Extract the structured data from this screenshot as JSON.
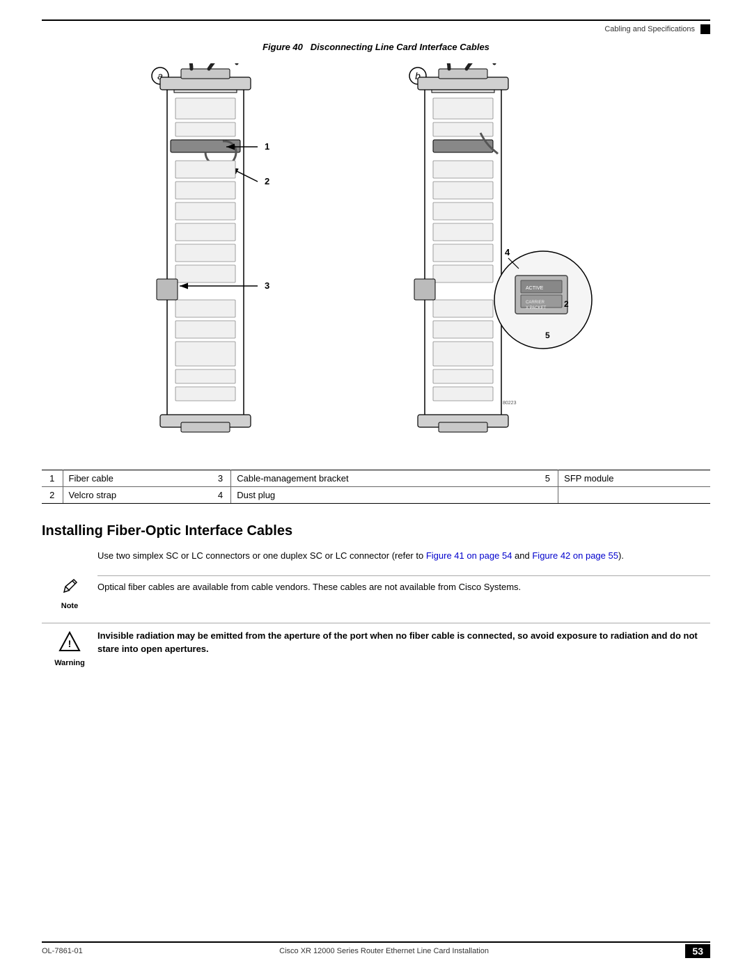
{
  "header": {
    "section_title": "Cabling and Specifications",
    "black_box": true
  },
  "figure": {
    "number": "40",
    "title": "Disconnecting Line Card Interface Cables",
    "label_a": "a",
    "label_b": "b"
  },
  "legend": {
    "rows": [
      {
        "num1": "1",
        "item1": "Fiber cable",
        "num2": "3",
        "item2": "Cable-management bracket",
        "num3": "5",
        "item3": "SFP module"
      },
      {
        "num1": "2",
        "item1": "Velcro strap",
        "num2": "4",
        "item2": "Dust plug",
        "num3": "",
        "item3": ""
      }
    ]
  },
  "section": {
    "heading": "Installing Fiber-Optic Interface Cables"
  },
  "body_text": "Use two simplex SC or LC connectors or one duplex SC or LC connector (refer to Figure 41 on page 54 and Figure 42 on page 55).",
  "body_link1": "Figure 41 on page 54",
  "body_link2": "Figure 42 on page 55",
  "note": {
    "label": "Note",
    "text": "Optical fiber cables are available from cable vendors. These cables are not available from Cisco Systems."
  },
  "warning": {
    "label": "Warning",
    "text": "Invisible radiation may be emitted from the aperture of the port when no fiber cable is connected, so avoid exposure to radiation and do not stare into open apertures."
  },
  "footer": {
    "left": "OL-7861-01",
    "center": "Cisco XR 12000 Series Router Ethernet Line Card Installation",
    "page_number": "53"
  }
}
